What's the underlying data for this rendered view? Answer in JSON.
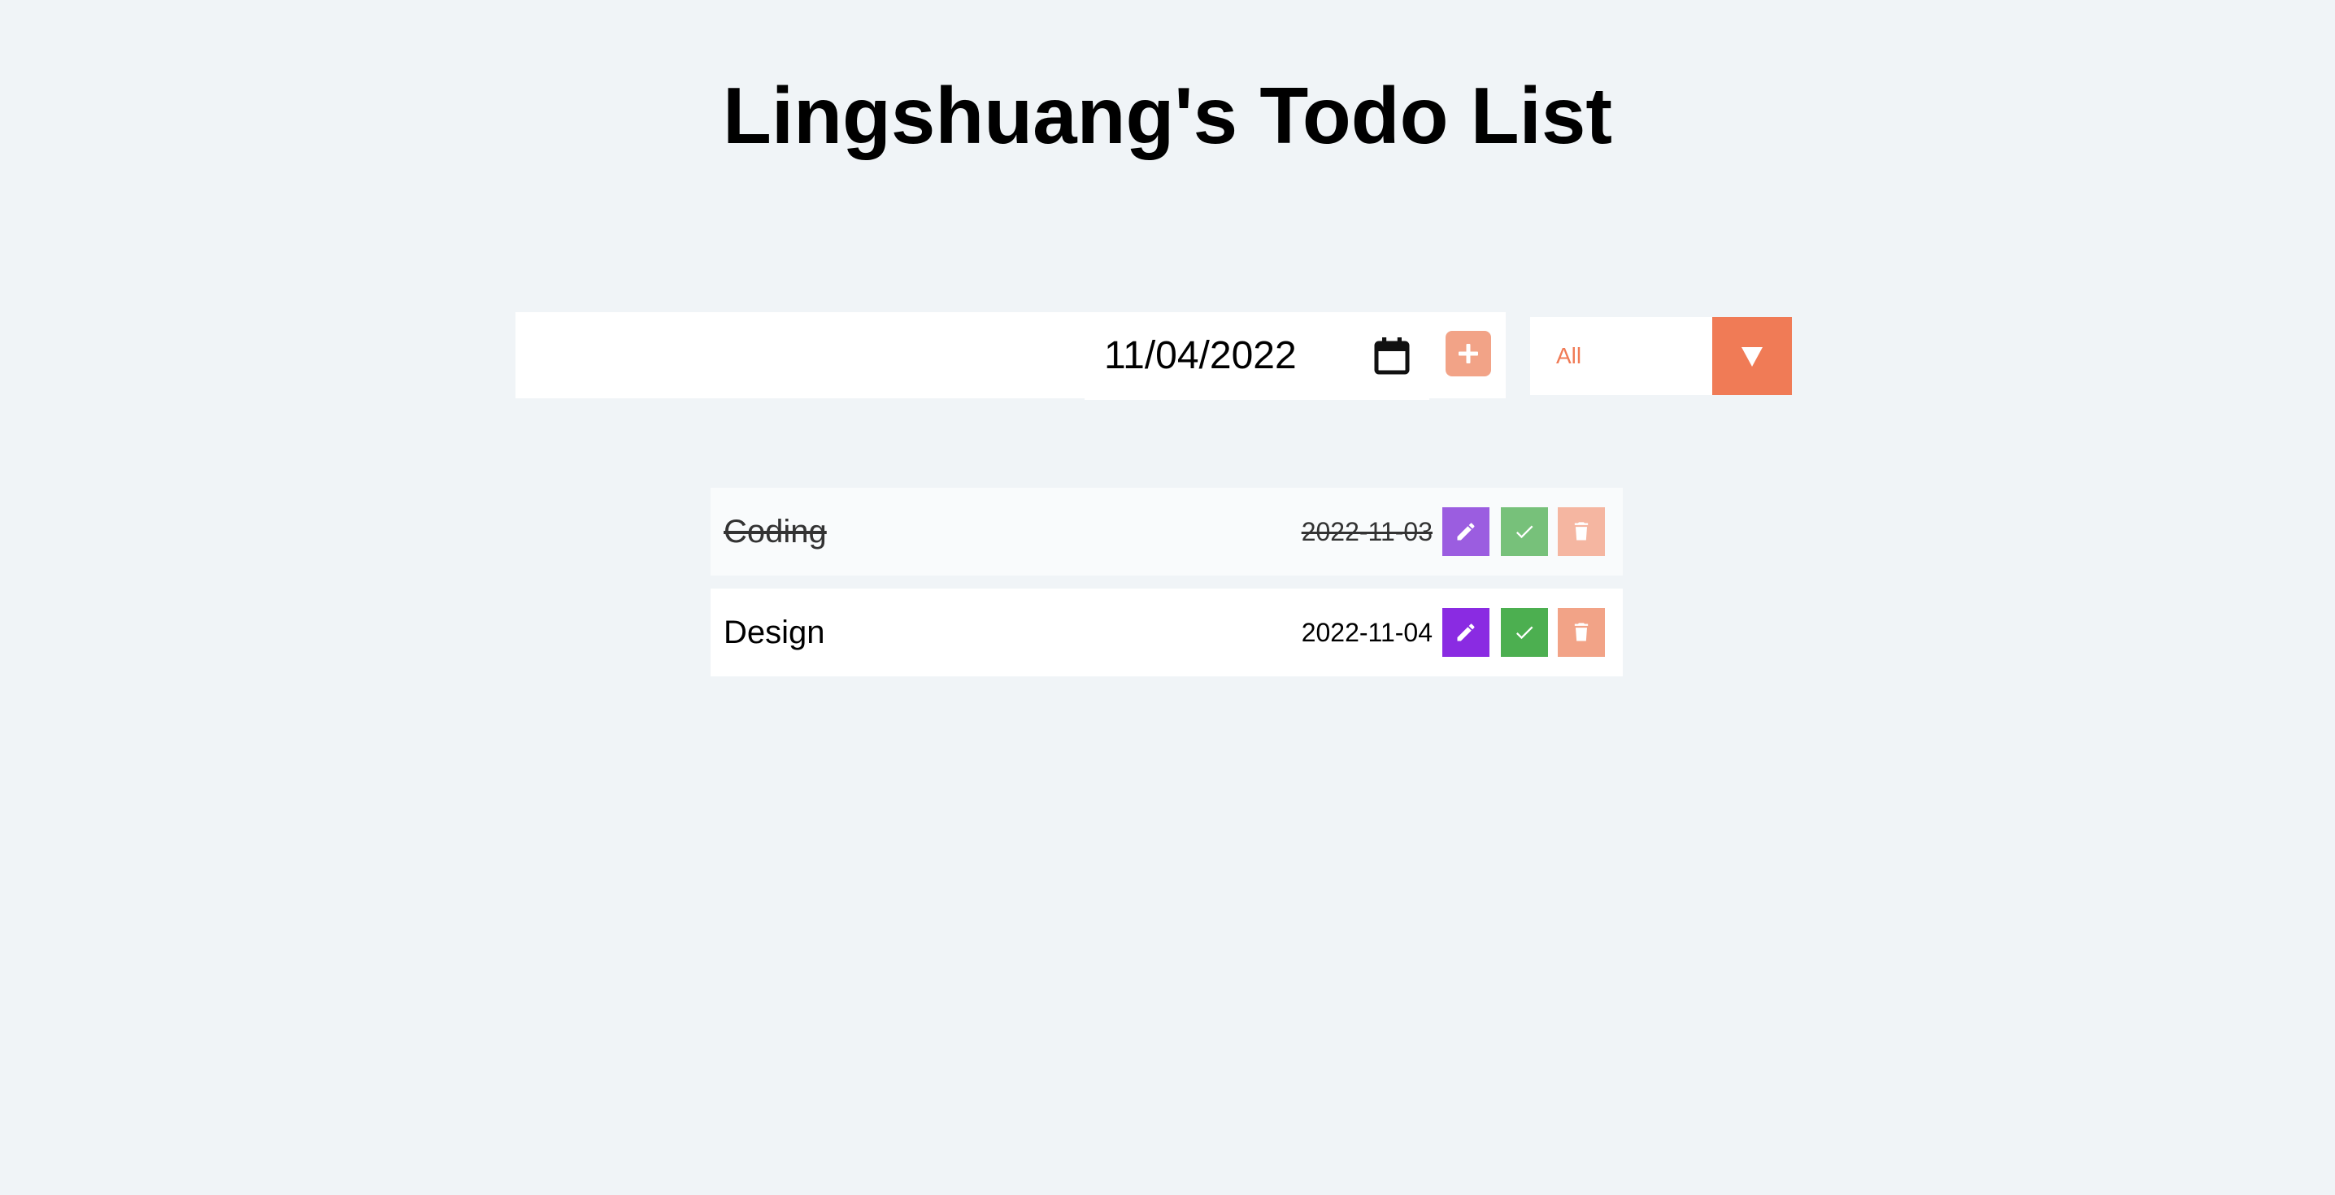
{
  "header": {
    "title": "Lingshuang's Todo List"
  },
  "input_bar": {
    "text_value": "",
    "text_placeholder": "",
    "date_value": "11/04/2022",
    "calendar_icon": "calendar-icon",
    "add_icon": "plus-icon"
  },
  "filter": {
    "selected": "All",
    "arrow_icon": "caret-down-icon"
  },
  "todos": [
    {
      "title": "Coding",
      "date": "2022-11-03",
      "completed": true,
      "actions": [
        "pencil-icon",
        "check-icon",
        "trash-icon"
      ]
    },
    {
      "title": "Design",
      "date": "2022-11-04",
      "completed": false,
      "actions": [
        "pencil-icon",
        "check-icon",
        "trash-icon"
      ]
    }
  ],
  "colors": {
    "background": "#f0f4f7",
    "accent": "#f07b56",
    "add_button": "#f2a387",
    "edit": "#8a2be2",
    "edit_completed": "#9b5de0",
    "check": "#4caf50",
    "check_completed": "#77c17a",
    "trash": "#f2a387",
    "trash_completed": "#f5b6a1"
  }
}
